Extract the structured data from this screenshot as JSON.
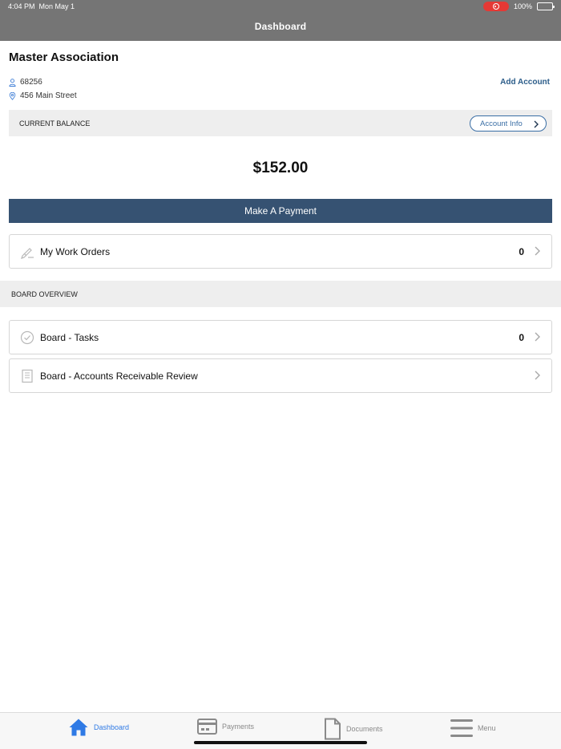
{
  "status_bar": {
    "time": "4:04 PM",
    "date": "Mon May 1",
    "battery": "100%"
  },
  "nav": {
    "title": "Dashboard"
  },
  "account": {
    "name": "Master Association",
    "id": "68256",
    "address": "456 Main Street",
    "add_account_label": "Add Account"
  },
  "balance": {
    "label": "CURRENT BALANCE",
    "account_info_label": "Account Info",
    "amount": "$152.00",
    "pay_label": "Make A Payment"
  },
  "work_orders": {
    "label": "My Work Orders",
    "count": "0"
  },
  "board": {
    "section_label": "BOARD OVERVIEW",
    "items": [
      {
        "label": "Board - Tasks",
        "count": "0",
        "icon": "check-circle-icon"
      },
      {
        "label": "Board - Accounts Receivable Review",
        "count": "",
        "icon": "document-list-icon"
      }
    ]
  },
  "tabs": [
    {
      "label": "Dashboard",
      "icon": "home-icon",
      "active": true
    },
    {
      "label": "Payments",
      "icon": "credit-card-icon",
      "active": false
    },
    {
      "label": "Documents",
      "icon": "document-icon",
      "active": false
    },
    {
      "label": "Menu",
      "icon": "hamburger-menu-icon",
      "active": false
    }
  ],
  "colors": {
    "nav_bg": "#757575",
    "primary_button": "#365272",
    "link": "#2c5d8a",
    "active_tab": "#2f7ae5"
  }
}
